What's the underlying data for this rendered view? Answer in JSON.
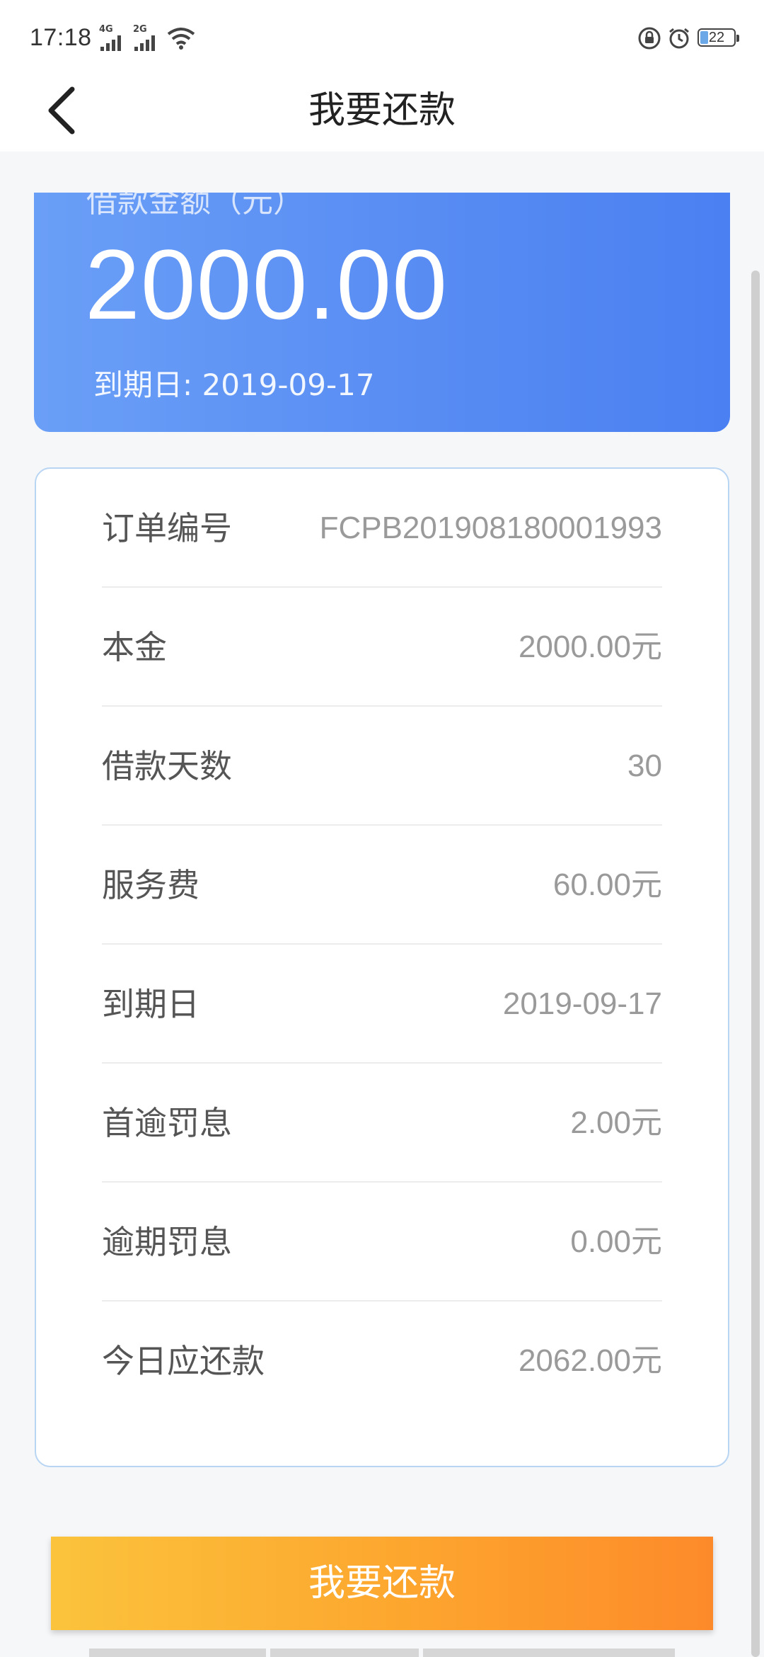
{
  "status_bar": {
    "time": "17:18",
    "sim1_network": "4G",
    "sim2_network": "2G",
    "battery_level": "22",
    "icons": [
      "signal-icon",
      "wifi-icon",
      "lock-icon",
      "alarm-icon",
      "battery-icon"
    ]
  },
  "header": {
    "title": "我要还款",
    "back_icon": "chevron-left-icon"
  },
  "loan_card": {
    "label": "借款金额（元）",
    "amount": "2000.00",
    "due_date": "到期日: 2019-09-17",
    "gradient_colors": [
      "#6a9ff7",
      "#4a80f2"
    ]
  },
  "details": {
    "rows": [
      {
        "label": "订单编号",
        "value": "FCPB201908180001993"
      },
      {
        "label": "本金",
        "value": "2000.00元"
      },
      {
        "label": "借款天数",
        "value": "30"
      },
      {
        "label": "服务费",
        "value": "60.00元"
      },
      {
        "label": "到期日",
        "value": "2019-09-17"
      },
      {
        "label": "首逾罚息",
        "value": "2.00元"
      },
      {
        "label": "逾期罚息",
        "value": "0.00元"
      },
      {
        "label": "今日应还款",
        "value": "2062.00元"
      }
    ]
  },
  "actions": {
    "repay_label": "我要还款",
    "button_colors": [
      "#fbc33c",
      "#fd8a2a"
    ]
  }
}
